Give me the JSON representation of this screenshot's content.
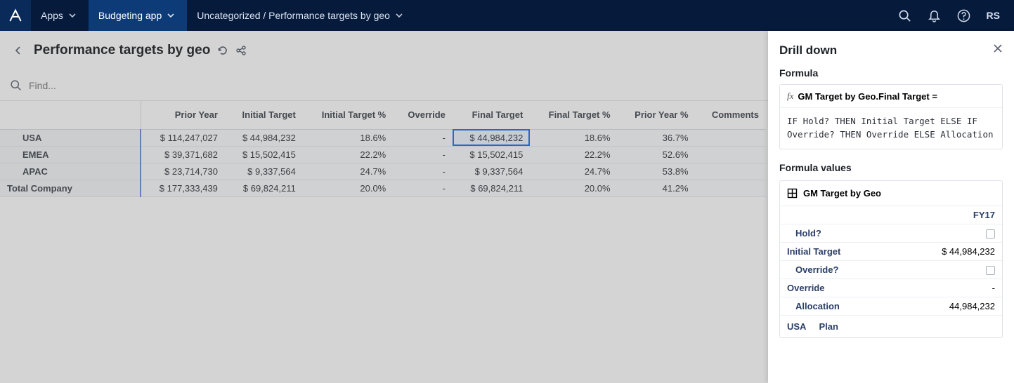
{
  "navbar": {
    "apps_label": "Apps",
    "app_name": "Budgeting app",
    "breadcrumb": "Uncategorized / Performance targets by geo",
    "user_initials": "RS"
  },
  "page": {
    "title": "Performance targets by geo",
    "plan_label": "Plan",
    "fy_label": "FY17",
    "find_placeholder": "Find..."
  },
  "grid": {
    "columns": [
      "Prior Year",
      "Initial Target",
      "Initial Target %",
      "Override",
      "Final Target",
      "Final Target %",
      "Prior Year %",
      "Comments"
    ],
    "rows": [
      {
        "name": "USA",
        "values": [
          "$ 114,247,027",
          "$ 44,984,232",
          "18.6%",
          "-",
          "$ 44,984,232",
          "18.6%",
          "36.7%",
          ""
        ]
      },
      {
        "name": "EMEA",
        "values": [
          "$ 39,371,682",
          "$ 15,502,415",
          "22.2%",
          "-",
          "$ 15,502,415",
          "22.2%",
          "52.6%",
          ""
        ]
      },
      {
        "name": "APAC",
        "values": [
          "$ 23,714,730",
          "$ 9,337,564",
          "24.7%",
          "-",
          "$ 9,337,564",
          "24.7%",
          "53.8%",
          ""
        ]
      }
    ],
    "total": {
      "name": "Total Company",
      "values": [
        "$ 177,333,439",
        "$ 69,824,211",
        "20.0%",
        "-",
        "$ 69,824,211",
        "20.0%",
        "41.2%",
        ""
      ]
    }
  },
  "drill": {
    "title": "Drill down",
    "formula_heading": "Formula",
    "formula_name": "GM Target by Geo.Final Target =",
    "formula_body": "IF Hold? THEN Initial Target ELSE IF Override? THEN Override ELSE Allocation",
    "values_heading": "Formula values",
    "module_name": "GM Target by Geo",
    "column_label": "FY17",
    "rows": [
      {
        "label": "Hold?",
        "value_is_checkbox": true,
        "indent": true
      },
      {
        "label": "Initial Target",
        "value": "$ 44,984,232",
        "indent": false
      },
      {
        "label": "Override?",
        "value_is_checkbox": true,
        "indent": true
      },
      {
        "label": "Override",
        "value": "-",
        "indent": false
      },
      {
        "label": "Allocation",
        "value": "44,984,232",
        "indent": true
      }
    ],
    "footer": [
      "USA",
      "Plan"
    ]
  }
}
